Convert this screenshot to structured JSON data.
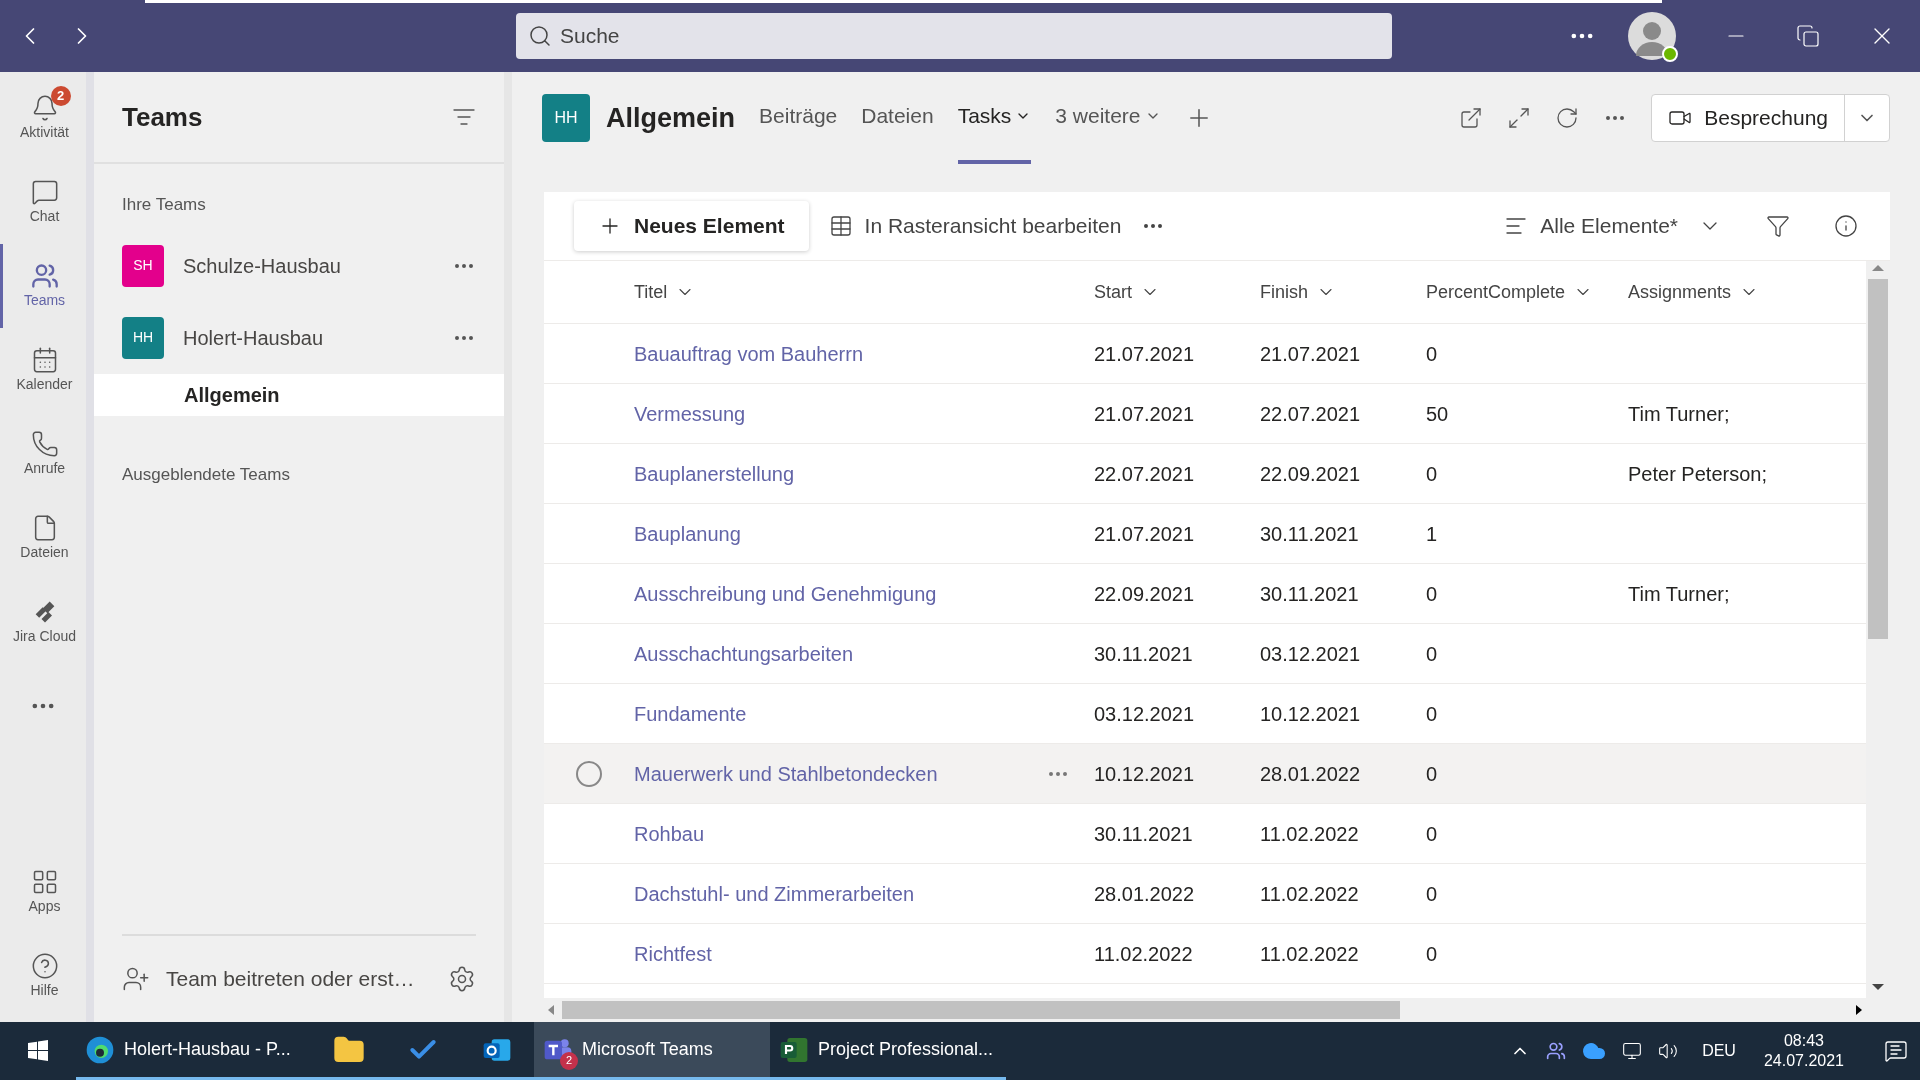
{
  "title_bar": {
    "search_placeholder": "Suche"
  },
  "rail": {
    "items": [
      {
        "label": "Aktivität",
        "kind": "bell",
        "badge": "2",
        "selected": false
      },
      {
        "label": "Chat",
        "kind": "chat",
        "selected": false
      },
      {
        "label": "Teams",
        "kind": "teams",
        "selected": true
      },
      {
        "label": "Kalender",
        "kind": "calendar",
        "selected": false
      },
      {
        "label": "Anrufe",
        "kind": "phone",
        "selected": false
      },
      {
        "label": "Dateien",
        "kind": "file",
        "selected": false
      },
      {
        "label": "Jira Cloud",
        "kind": "jira",
        "selected": false
      }
    ],
    "bottom_items": [
      {
        "label": "Apps",
        "kind": "apps",
        "selected": false
      },
      {
        "label": "Hilfe",
        "kind": "help",
        "selected": false
      }
    ]
  },
  "teams_panel": {
    "title": "Teams",
    "section": "Ihre Teams",
    "teams": [
      {
        "initials": "SH",
        "name": "Schulze-Hausbau",
        "color": "#e3008c"
      },
      {
        "initials": "HH",
        "name": "Holert-Hausbau",
        "color": "#138086",
        "channels": [
          {
            "name": "Allgemein",
            "selected": true
          }
        ]
      }
    ],
    "hidden_section": "Ausgeblendete Teams",
    "footer": "Team beitreten oder erst…"
  },
  "channel": {
    "initials": "HH",
    "title": "Allgemein",
    "tabs": [
      {
        "label": "Beiträge",
        "selected": false,
        "dropdown": false
      },
      {
        "label": "Dateien",
        "selected": false,
        "dropdown": false
      },
      {
        "label": "Tasks",
        "selected": true,
        "dropdown": true
      },
      {
        "label": "3 weitere",
        "selected": false,
        "dropdown": true
      }
    ],
    "meeting_button": "Besprechung"
  },
  "toolbar": {
    "new_item": "Neues Element",
    "grid_edit": "In Rasteransicht bearbeiten",
    "view": "Alle Elemente*"
  },
  "table": {
    "columns": [
      "Titel",
      "Start",
      "Finish",
      "PercentComplete",
      "Assignments"
    ],
    "rows": [
      {
        "cells": [
          "Bauauftrag vom Bauherrn",
          "21.07.2021",
          "21.07.2021",
          "0",
          ""
        ],
        "hovered": false
      },
      {
        "cells": [
          "Vermessung",
          "21.07.2021",
          "22.07.2021",
          "50",
          "Tim Turner;"
        ],
        "hovered": false
      },
      {
        "cells": [
          "Bauplanerstellung",
          "22.07.2021",
          "22.09.2021",
          "0",
          "Peter Peterson;"
        ],
        "hovered": false
      },
      {
        "cells": [
          "Bauplanung",
          "21.07.2021",
          "30.11.2021",
          "1",
          ""
        ],
        "hovered": false
      },
      {
        "cells": [
          "Ausschreibung und Genehmigung",
          "22.09.2021",
          "30.11.2021",
          "0",
          "Tim Turner;"
        ],
        "hovered": false
      },
      {
        "cells": [
          "Ausschachtungsarbeiten",
          "30.11.2021",
          "03.12.2021",
          "0",
          ""
        ],
        "hovered": false
      },
      {
        "cells": [
          "Fundamente",
          "03.12.2021",
          "10.12.2021",
          "0",
          ""
        ],
        "hovered": false
      },
      {
        "cells": [
          "Mauerwerk und Stahlbetondecken",
          "10.12.2021",
          "28.01.2022",
          "0",
          ""
        ],
        "hovered": true
      },
      {
        "cells": [
          "Rohbau",
          "30.11.2021",
          "11.02.2022",
          "0",
          ""
        ],
        "hovered": false
      },
      {
        "cells": [
          "Dachstuhl- und Zimmerarbeiten",
          "28.01.2022",
          "11.02.2022",
          "0",
          ""
        ],
        "hovered": false
      },
      {
        "cells": [
          "Richtfest",
          "11.02.2022",
          "11.02.2022",
          "0",
          ""
        ],
        "hovered": false
      }
    ]
  },
  "taskbar": {
    "items": [
      {
        "kind": "edge",
        "label": "Holert-Hausbau - P...",
        "selected": false
      },
      {
        "kind": "explorer",
        "selected": false
      },
      {
        "kind": "todo",
        "selected": false
      },
      {
        "kind": "outlook",
        "selected": false
      },
      {
        "kind": "teams",
        "label": "Microsoft Teams",
        "badge": "2",
        "selected": true
      },
      {
        "kind": "project",
        "label": "Project Professional...",
        "selected": false
      }
    ],
    "language": "DEU",
    "time": "08:43",
    "date": "24.07.2021"
  }
}
